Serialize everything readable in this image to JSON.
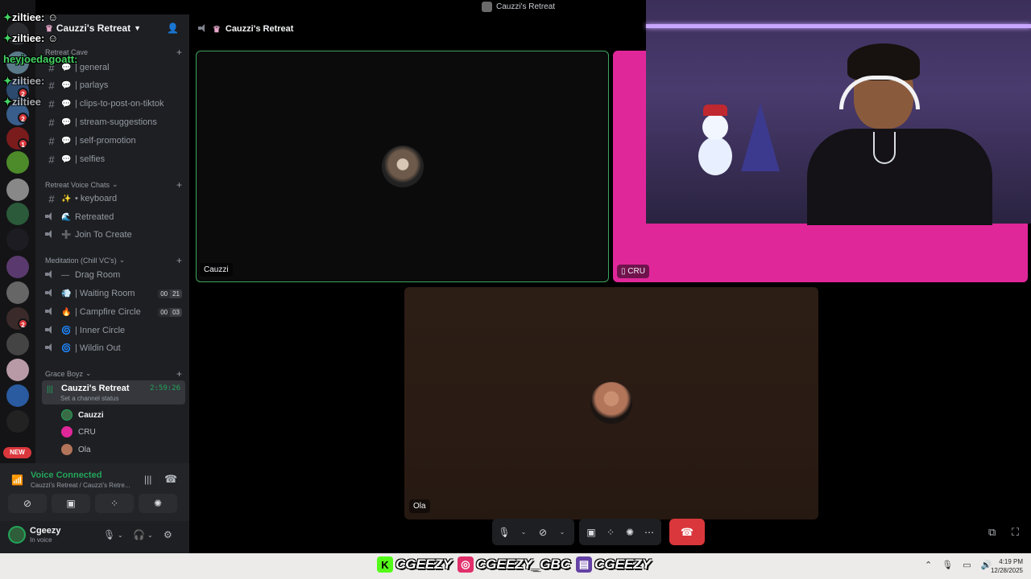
{
  "window": {
    "title": "Cauzzi's Retreat"
  },
  "server": {
    "name": "Cauzzi's Retreat"
  },
  "overlay_chat": [
    {
      "user": "ziltiee:",
      "color": "#ffffff"
    },
    {
      "user": "ziltiee:",
      "color": "#ffffff"
    },
    {
      "user": "heyjoedagoatt:",
      "color": "#43d463"
    },
    {
      "user": "ziltiee:",
      "color": "#dfe2e6"
    },
    {
      "user": "ziltiee",
      "color": "#dfe2e6"
    }
  ],
  "rail": {
    "badges": [
      "2",
      "2",
      "2",
      "1",
      "2"
    ],
    "new_label": "NEW"
  },
  "categories": {
    "retreat_cave": "Retreat Cave",
    "retreat_voice": "Retreat Voice Chats",
    "meditation": "Meditation (Chill VC's)",
    "grace_boyz": "Grace Boyz"
  },
  "text_channels": [
    {
      "emoji": "💬",
      "name": "| general"
    },
    {
      "emoji": "💬",
      "name": "| parlays"
    },
    {
      "emoji": "💬",
      "name": "| clips-to-post-on-tiktok"
    },
    {
      "emoji": "💬",
      "name": "| stream-suggestions"
    },
    {
      "emoji": "💬",
      "name": "| self-promotion"
    },
    {
      "emoji": "💬",
      "name": "| selfies"
    }
  ],
  "voice_channels_1": [
    {
      "emoji": "✨",
      "name": "• keyboard",
      "type": "text"
    },
    {
      "emoji": "🌊",
      "name": "Retreated",
      "type": "voice"
    },
    {
      "emoji": "➕",
      "name": "Join To Create",
      "type": "voice"
    }
  ],
  "voice_channels_2": [
    {
      "emoji": "—",
      "name": "Drag Room",
      "count": null
    },
    {
      "emoji": "💨",
      "name": "| Waiting Room",
      "count": [
        "00",
        "21"
      ]
    },
    {
      "emoji": "🔥",
      "name": "| Campfire Circle",
      "count": [
        "00",
        "03"
      ]
    },
    {
      "emoji": "🌀",
      "name": "| Inner Circle",
      "count": null
    },
    {
      "emoji": "🌀",
      "name": "| Wildin Out",
      "count": null
    }
  ],
  "active_channel": {
    "name": "Cauzzi's Retreat",
    "time": "2:59:26",
    "status": "Set a channel status"
  },
  "members": [
    {
      "name": "Cauzzi",
      "color": "#3a6a46",
      "self": true
    },
    {
      "name": "CRU",
      "color": "#e0279a",
      "self": false
    },
    {
      "name": "Ola",
      "color": "#b2755a",
      "self": false
    }
  ],
  "voice_panel": {
    "connected": "Voice Connected",
    "subtitle": "Cauzzi's Retreat / Cauzzi's Retre..."
  },
  "user": {
    "name": "Cgeezy",
    "status": "In voice"
  },
  "call_header": {
    "title": "Cauzzi's Retreat"
  },
  "tiles": [
    {
      "name": "Cauzzi",
      "speaking": true
    },
    {
      "name": "CRU",
      "mobile": true
    },
    {
      "name": "Ola"
    }
  ],
  "taskbar": {
    "socials": [
      {
        "icon": "kick-icon",
        "handle": "CGEEZY",
        "color": "#53fc18"
      },
      {
        "icon": "instagram-icon",
        "handle": "CGEEZY_GBC",
        "color": "#e1306c"
      },
      {
        "icon": "twitch-icon",
        "handle": "CGEEZY",
        "color": "#6441a5"
      }
    ],
    "time": "4:19 PM",
    "date": "12/28/2025"
  },
  "colors": {
    "accent_green": "#23a55a",
    "danger": "#da373c",
    "cru_tile": "#e0279a"
  }
}
